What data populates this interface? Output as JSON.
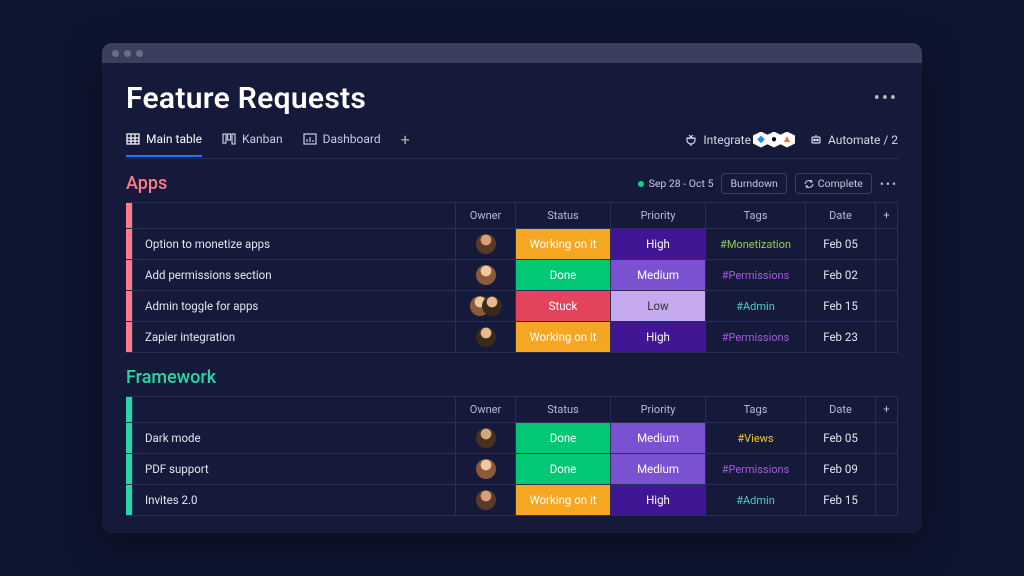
{
  "title": "Feature Requests",
  "tabs": [
    {
      "label": "Main table"
    },
    {
      "label": "Kanban"
    },
    {
      "label": "Dashboard"
    }
  ],
  "right": {
    "integrate": "Integrate",
    "automate": "Automate / 2"
  },
  "columns": [
    "",
    "",
    "Owner",
    "Status",
    "Priority",
    "Tags",
    "Date",
    "+"
  ],
  "groups": [
    {
      "name": "Apps",
      "controls": {
        "date_range": "Sep 28 - Oct 5",
        "burndown": "Burndown",
        "complete": "Complete"
      },
      "rows": [
        {
          "name": "Option to monetize apps",
          "owner": "a1",
          "status": "Working on it",
          "status_cls": "working",
          "priority": "High",
          "priority_cls": "high",
          "tag": "#Monetization",
          "tag_cls": "mon",
          "date": "Feb 05"
        },
        {
          "name": "Add permissions section",
          "owner": "a2",
          "status": "Done",
          "status_cls": "done",
          "priority": "Medium",
          "priority_cls": "medium",
          "tag": "#Permissions",
          "tag_cls": "perm",
          "date": "Feb 02"
        },
        {
          "name": "Admin toggle for apps",
          "owner": "pair",
          "status": "Stuck",
          "status_cls": "stuck",
          "priority": "Low",
          "priority_cls": "low",
          "tag": "#Admin",
          "tag_cls": "admin",
          "date": "Feb 15"
        },
        {
          "name": "Zapier integration",
          "owner": "a3",
          "status": "Working on it",
          "status_cls": "working",
          "priority": "High",
          "priority_cls": "high",
          "tag": "#Permissions",
          "tag_cls": "perm",
          "date": "Feb 23"
        }
      ]
    },
    {
      "name": "Framework",
      "rows": [
        {
          "name": "Dark mode",
          "owner": "a4",
          "status": "Done",
          "status_cls": "done",
          "priority": "Medium",
          "priority_cls": "medium",
          "tag": "#Views",
          "tag_cls": "views",
          "date": "Feb 05"
        },
        {
          "name": "PDF support",
          "owner": "a2",
          "status": "Done",
          "status_cls": "done",
          "priority": "Medium",
          "priority_cls": "medium",
          "tag": "#Permissions",
          "tag_cls": "perm",
          "date": "Feb 09"
        },
        {
          "name": "Invites 2.0",
          "owner": "a1",
          "status": "Working on it",
          "status_cls": "working",
          "priority": "High",
          "priority_cls": "high",
          "tag": "#Admin",
          "tag_cls": "admin",
          "date": "Feb 15"
        }
      ]
    }
  ]
}
